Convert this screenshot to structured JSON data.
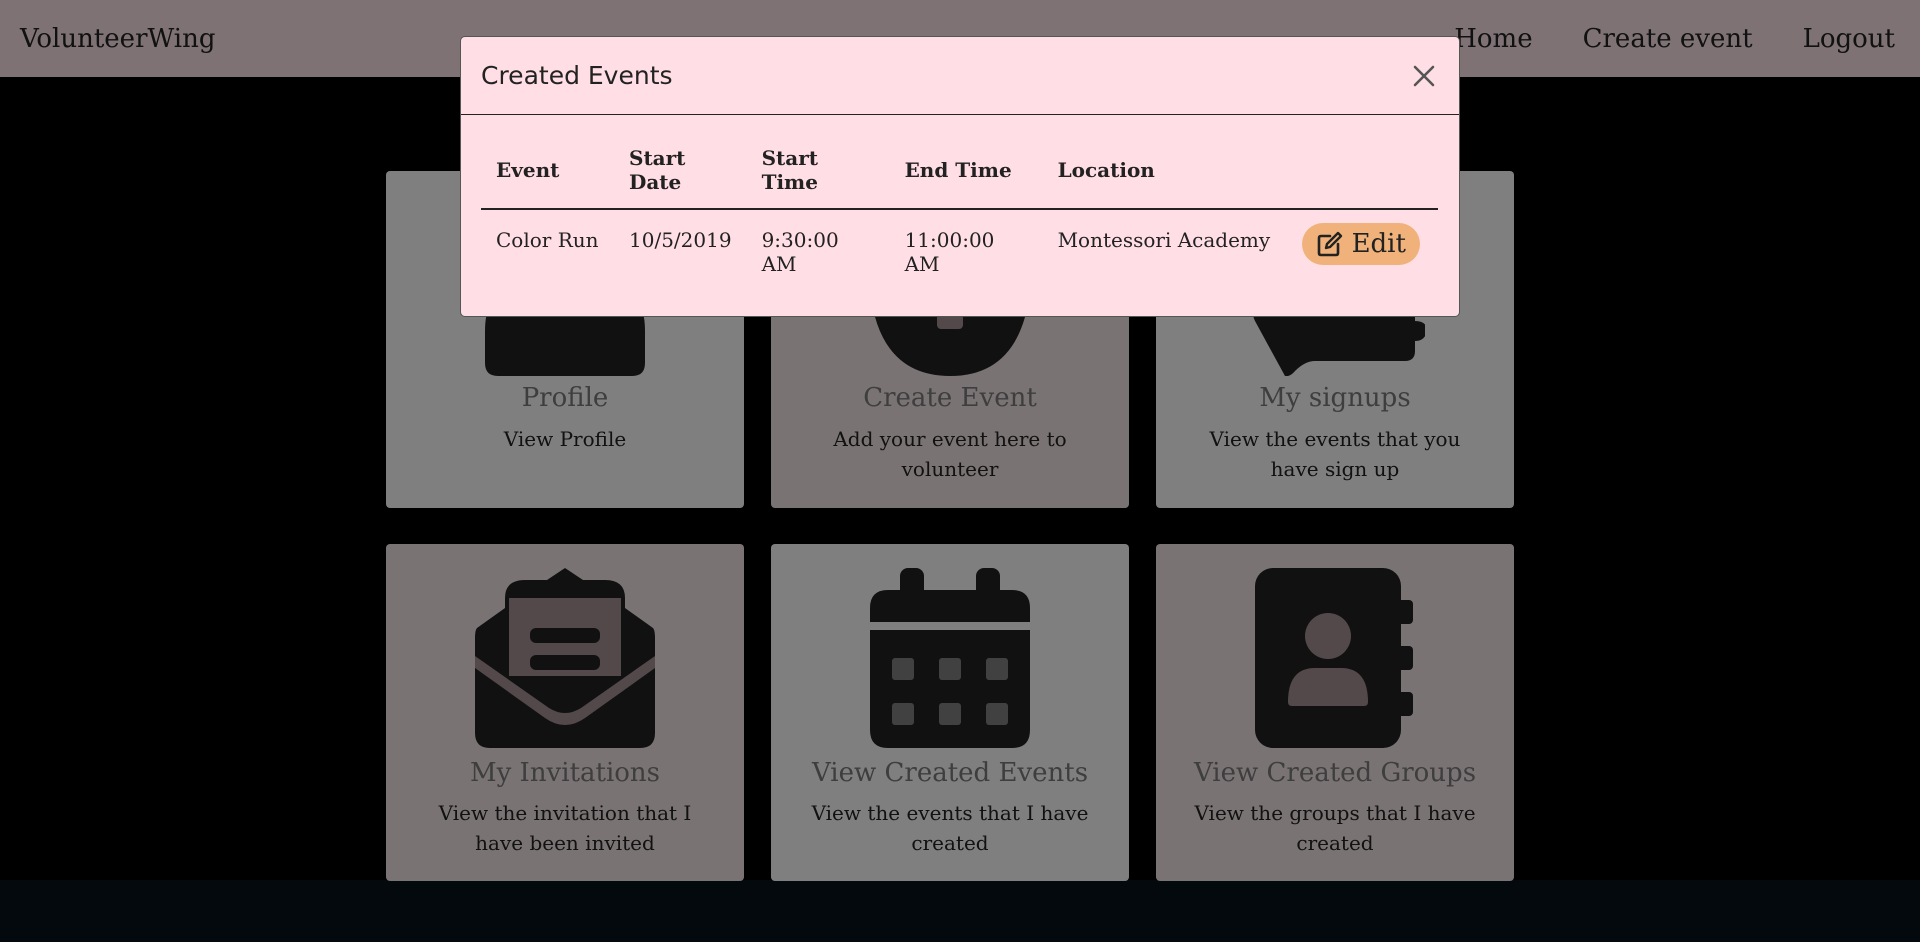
{
  "navbar": {
    "brand": "VolunteerWing",
    "links": [
      "Home",
      "Create event",
      "Logout"
    ]
  },
  "cards": [
    {
      "title": "Profile",
      "desc": "View Profile",
      "icon": "user-icon",
      "tone": "gray"
    },
    {
      "title": "Create Event",
      "desc": "Add your event here to volunteer",
      "icon": "plus-circle-icon",
      "tone": "pink"
    },
    {
      "title": "My signups",
      "desc": "View the events that you have sign up",
      "icon": "hand-icon",
      "tone": "gray"
    },
    {
      "title": "My Invitations",
      "desc": "View the invitation that I have been invited",
      "icon": "envelope-open-icon",
      "tone": "pink"
    },
    {
      "title": "View Created Events",
      "desc": "View the events that I have created",
      "icon": "calendar-icon",
      "tone": "gray"
    },
    {
      "title": "View Created Groups",
      "desc": "View the groups that I have created",
      "icon": "address-book-icon",
      "tone": "pink"
    }
  ],
  "modal": {
    "title": "Created Events",
    "close_icon": "close-icon",
    "columns": [
      "Event",
      "Start Date",
      "Start Time",
      "End Time",
      "Location"
    ],
    "rows": [
      {
        "event": "Color Run",
        "start_date": "10/5/2019",
        "start_time": "9:30:00 AM",
        "end_time": "11:00:00 AM",
        "location": "Montessori Academy",
        "action": "Edit"
      }
    ]
  },
  "colors": {
    "navbar_bg": "#fce4e9",
    "modal_bg": "#ffdfe5",
    "edit_button": "#f0b27a",
    "card_gray": "#fefefe",
    "card_pink": "#f5e6e8"
  }
}
